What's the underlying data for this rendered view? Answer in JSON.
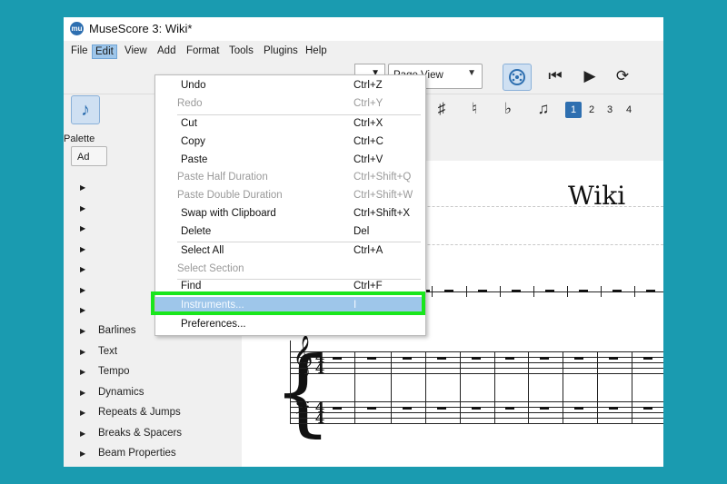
{
  "window": {
    "title": "MuseScore 3: Wiki*",
    "app_icon": "mu"
  },
  "menubar": [
    "File",
    "Edit",
    "View",
    "Add",
    "Format",
    "Tools",
    "Plugins",
    "Help"
  ],
  "toolbar": {
    "view_mode": "Page View",
    "voices": [
      "1",
      "2",
      "3",
      "4"
    ]
  },
  "palette": {
    "header": "Palette",
    "add_button": "Ad",
    "items": [
      "Barlines",
      "Text",
      "Tempo",
      "Dynamics",
      "Repeats & Jumps",
      "Breaks & Spacers",
      "Beam Properties"
    ]
  },
  "score": {
    "title": "Wiki",
    "tab_close": "x"
  },
  "edit_menu": [
    {
      "label": "Undo",
      "shortcut": "Ctrl+Z",
      "enabled": true
    },
    {
      "label": "Redo",
      "shortcut": "Ctrl+Y",
      "enabled": false
    },
    {
      "label": "Cut",
      "shortcut": "Ctrl+X",
      "enabled": true
    },
    {
      "label": "Copy",
      "shortcut": "Ctrl+C",
      "enabled": true
    },
    {
      "label": "Paste",
      "shortcut": "Ctrl+V",
      "enabled": true
    },
    {
      "label": "Paste Half Duration",
      "shortcut": "Ctrl+Shift+Q",
      "enabled": false
    },
    {
      "label": "Paste Double Duration",
      "shortcut": "Ctrl+Shift+W",
      "enabled": false
    },
    {
      "label": "Swap with Clipboard",
      "shortcut": "Ctrl+Shift+X",
      "enabled": true
    },
    {
      "label": "Delete",
      "shortcut": "Del",
      "enabled": true
    },
    {
      "label": "Select All",
      "shortcut": "Ctrl+A",
      "enabled": true
    },
    {
      "label": "Select Section",
      "shortcut": "",
      "enabled": false
    },
    {
      "label": "Find",
      "shortcut": "Ctrl+F",
      "enabled": true
    },
    {
      "label": "Instruments...",
      "shortcut": "I",
      "enabled": true,
      "highlighted": true
    },
    {
      "label": "Preferences...",
      "shortcut": "",
      "enabled": true
    }
  ],
  "colors": {
    "background": "#1a9bb0",
    "highlight_box": "#19e61c",
    "selection": "#9ec6ea",
    "accent": "#2e6fb0"
  }
}
